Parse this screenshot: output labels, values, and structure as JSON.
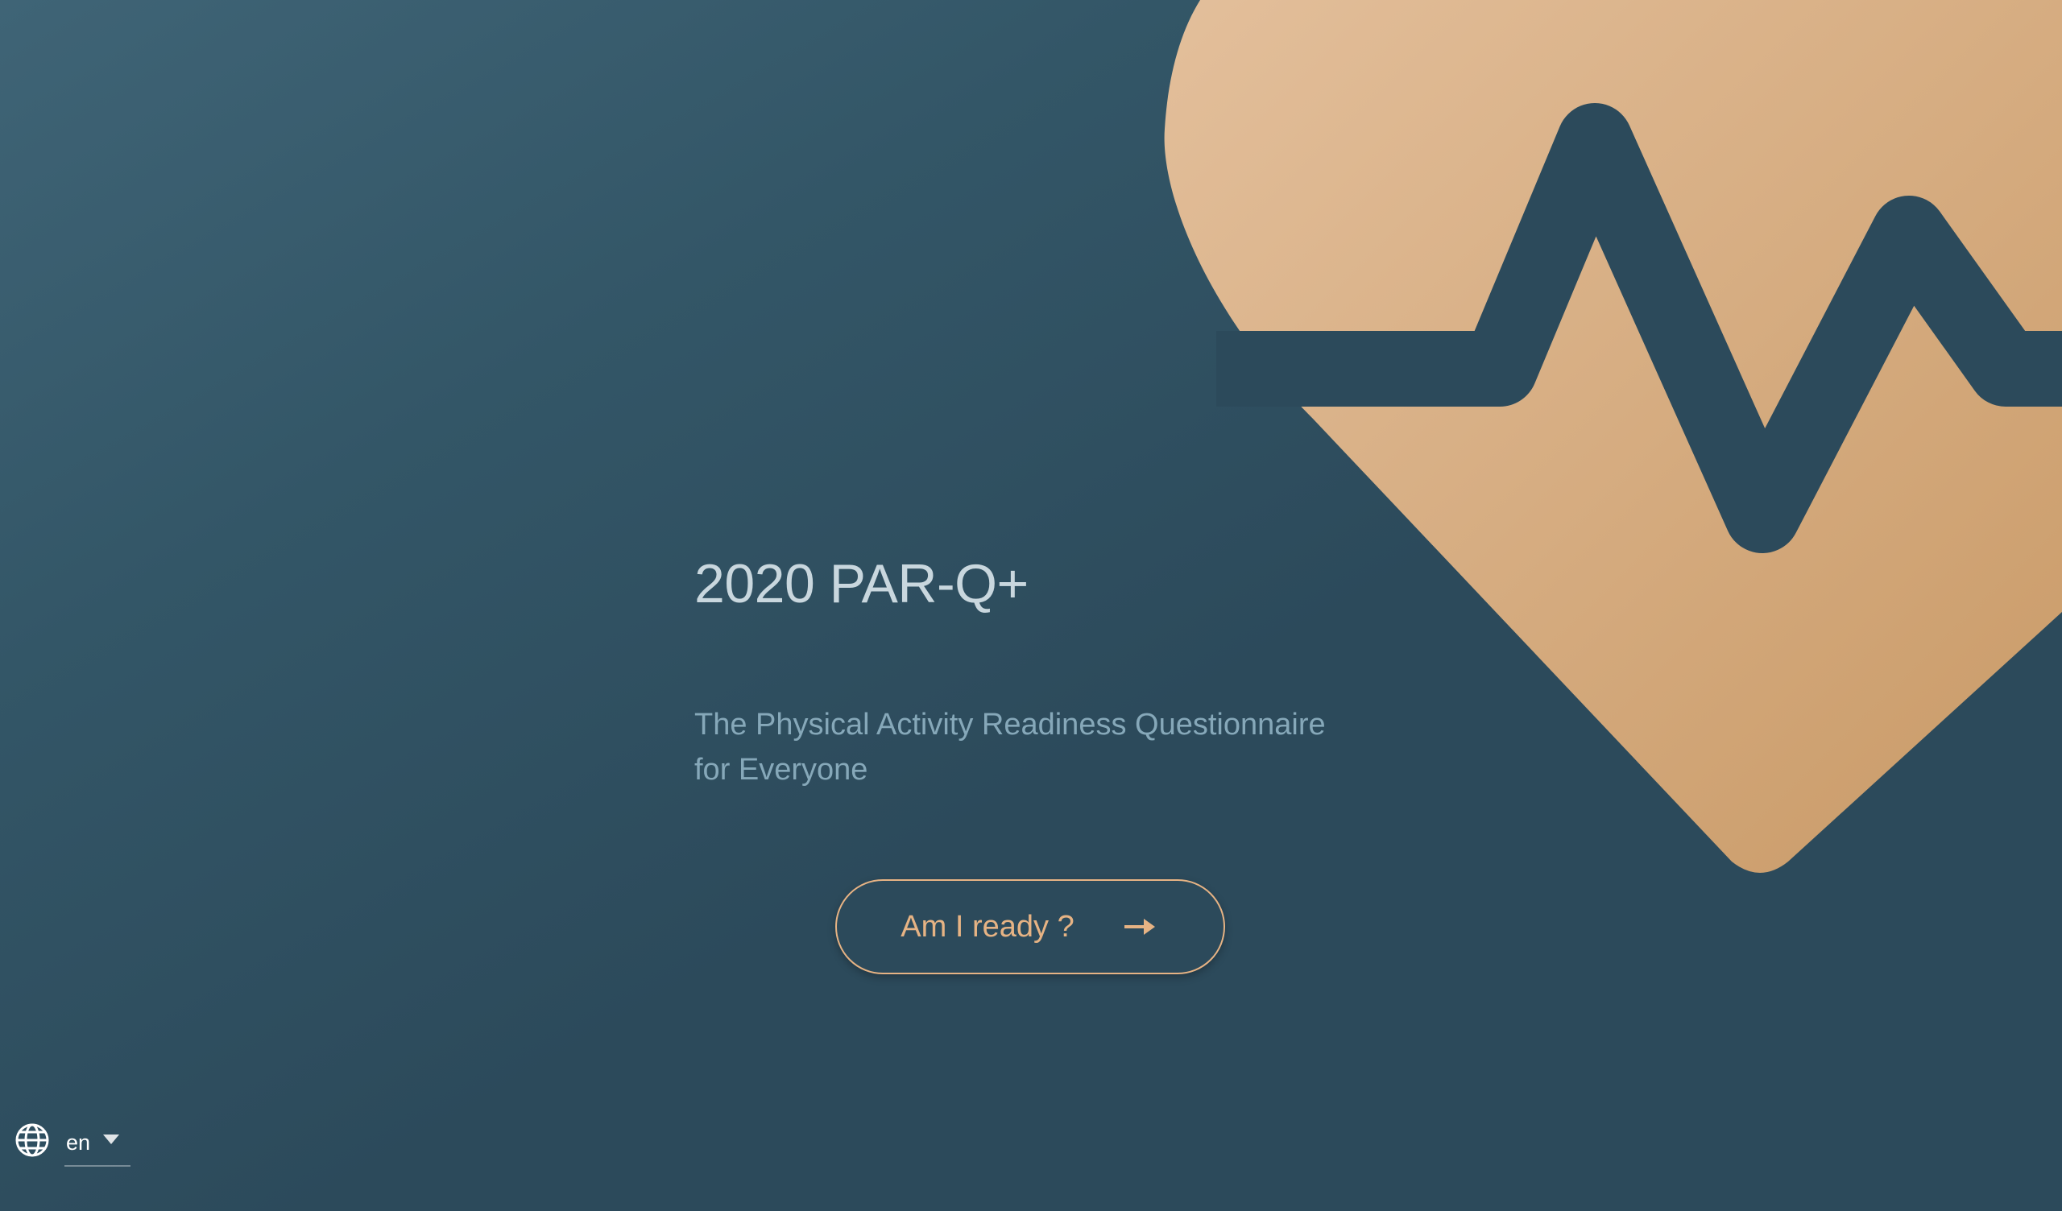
{
  "hero": {
    "title": "2020 PAR-Q+",
    "subtitle_line1": "The Physical Activity Readiness Questionnaire",
    "subtitle_line2": "for Everyone"
  },
  "cta": {
    "label": "Am I ready ?",
    "icon": "arrow-right-icon"
  },
  "language_selector": {
    "icon": "globe-icon",
    "selected": "en",
    "dropdown_icon": "chevron-down-icon"
  },
  "graphic": {
    "icon": "heart-pulse-icon"
  },
  "colors": {
    "background_light": "#3f6476",
    "background_dark": "#2c4a5b",
    "accent": "#e6b384",
    "heart_light": "#e3bf9b",
    "heart_dark": "#c99a67",
    "title_text": "#c9d7de",
    "subtitle_text": "#86a8b9",
    "white": "#ffffff"
  }
}
